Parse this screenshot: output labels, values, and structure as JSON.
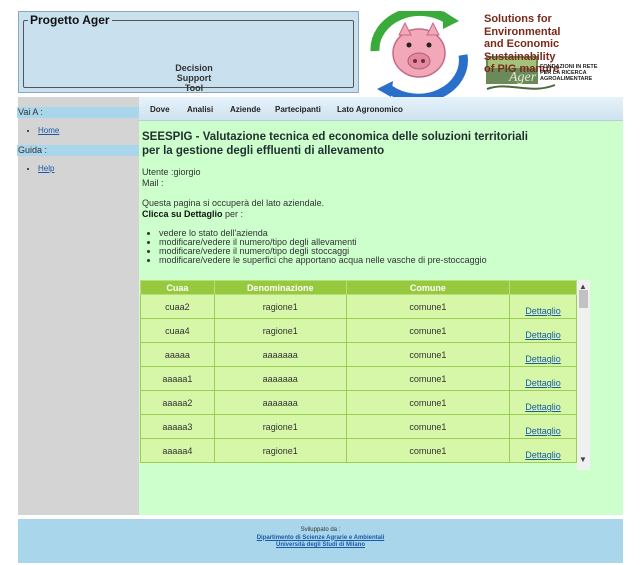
{
  "header": {
    "title": "Progetto Ager",
    "tagline_lines": [
      "Decision",
      "Support",
      "Tool"
    ],
    "brand_lines": [
      "Solutions for Environmental",
      "and Economic Sustainability",
      "of PIG manure"
    ],
    "fondazioni_lines": [
      "FONDAZIONI IN RETE",
      "PER LA RICERCA",
      "AGROALIMENTARE"
    ],
    "colors": {
      "panel": "#c9e0ee",
      "brand_text": "#7a2a1a"
    }
  },
  "sidebar": {
    "vai_a": "Vai A :",
    "home": "Home",
    "guida": "Guida :",
    "help": "Help"
  },
  "nav": {
    "items": [
      "Dove",
      "Analisi",
      "Aziende",
      "Partecipanti",
      "Lato Agronomico"
    ]
  },
  "main": {
    "title_line1": "SEESPIG - Valutazione tecnica ed economica delle soluzioni territoriali",
    "title_line2": "per la gestione degli effluenti di allevamento",
    "utente": "Utente :giorgio",
    "mail": "Mail :",
    "intro_line1": "Questa pagina si occuperà del lato aziendale.",
    "intro_bold": "Clicca su Dettaglio",
    "intro_rest": " per :",
    "bullets": [
      "vedere lo stato dell'azienda",
      "modificare/vedere il numero/tipo degli allevamenti",
      "modificare/vedere il numero/tipo degli stoccaggi",
      "modificare/vedere le superfici che apportano acqua nelle vasche di pre-stoccaggio"
    ]
  },
  "table": {
    "headers": [
      "Cuaa",
      "Denominazione",
      "Comune",
      ""
    ],
    "link_label": "Dettaglio",
    "rows": [
      {
        "cuaa": "cuaa2",
        "denominazione": "ragione1",
        "comune": "comune1"
      },
      {
        "cuaa": "cuaa4",
        "denominazione": "ragione1",
        "comune": "comune1"
      },
      {
        "cuaa": "aaaaa",
        "denominazione": "aaaaaaa",
        "comune": "comune1"
      },
      {
        "cuaa": "aaaaa1",
        "denominazione": "aaaaaaa",
        "comune": "comune1"
      },
      {
        "cuaa": "aaaaa2",
        "denominazione": "aaaaaaa",
        "comune": "comune1"
      },
      {
        "cuaa": "aaaaa3",
        "denominazione": "ragione1",
        "comune": "comune1"
      },
      {
        "cuaa": "aaaaa4",
        "denominazione": "ragione1",
        "comune": "comune1"
      }
    ],
    "colors": {
      "header_bg": "#96c93d",
      "cell_bg": "#d7f7a8"
    }
  },
  "footer": {
    "developed_by": "Sviluppato da :",
    "dept": "Dipartimento di Scienze Agrarie e Ambientali",
    "univ": "Università degli Studi di Milano"
  }
}
